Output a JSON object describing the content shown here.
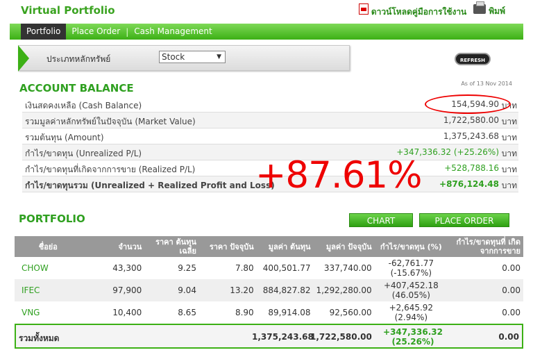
{
  "header": {
    "title": "Virtual Portfolio",
    "download_manual": "ดาวน์โหลดคู่มือการใช้งาน",
    "print": "พิมพ์"
  },
  "nav": {
    "tabs": [
      "Portfolio",
      "Place Order",
      "Cash Management"
    ],
    "active": "Portfolio"
  },
  "asset_type": {
    "label": "ประเภทหลักทรัพย์",
    "selected": "Stock"
  },
  "refresh_label": "REFRESH",
  "account_balance": {
    "title": "ACCOUNT BALANCE",
    "as_of": "As of 13 Nov 2014",
    "unit": "บาท",
    "rows": [
      {
        "label": "เงินสดคงเหลือ (Cash Balance)",
        "value": "154,594.90"
      },
      {
        "label": "รวมมูลค่าหลักทรัพย์ในปัจจุบัน (Market Value)",
        "value": "1,722,580.00"
      },
      {
        "label": "รวมต้นทุน (Amount)",
        "value": "1,375,243.68"
      },
      {
        "label": "กำไร/ขาดทุน (Unrealized P/L)",
        "value": "+347,336.32 (+25.26%)"
      },
      {
        "label": "กำไร/ขาดทุนที่เกิดจากการขาย (Realized P/L)",
        "value": "+528,788.16"
      },
      {
        "label": "กำไร/ขาดทุนรวม (Unrealized + Realized Profit and Loss)",
        "value": "+876,124.48"
      }
    ]
  },
  "annotation": "+87.61%",
  "portfolio": {
    "title": "PORTFOLIO",
    "chart_button": "CHART",
    "place_order_button": "PLACE ORDER",
    "columns": [
      "ชื่อย่อ",
      "จำนวน",
      "ราคา ต้นทุนเฉลี่ย",
      "ราคา ปัจจุบัน",
      "มูลค่า ต้นทุน",
      "มูลค่า ปัจจุบัน",
      "กำไร/ขาดทุน (%)",
      "กำไร/ขาดทุนที่ เกิดจากการขาย"
    ],
    "rows": [
      {
        "symbol": "CHOW",
        "qty": "43,300",
        "avg_cost": "9.25",
        "price": "7.80",
        "cost_value": "400,501.77",
        "market_value": "337,740.00",
        "pl": "-62,761.77",
        "pl_pct": "(-15.67%)",
        "realized": "0.00"
      },
      {
        "symbol": "IFEC",
        "qty": "97,900",
        "avg_cost": "9.04",
        "price": "13.20",
        "cost_value": "884,827.82",
        "market_value": "1,292,280.00",
        "pl": "+407,452.18",
        "pl_pct": "(46.05%)",
        "realized": "0.00"
      },
      {
        "symbol": "VNG",
        "qty": "10,400",
        "avg_cost": "8.65",
        "price": "8.90",
        "cost_value": "89,914.08",
        "market_value": "92,560.00",
        "pl": "+2,645.92",
        "pl_pct": "(2.94%)",
        "realized": "0.00"
      }
    ],
    "total": {
      "label": "รวมทั้งหมด",
      "cost_value": "1,375,243.68",
      "market_value": "1,722,580.00",
      "pl": "+347,336.32",
      "pl_pct": "(25.26%)",
      "realized": "0.00"
    }
  }
}
